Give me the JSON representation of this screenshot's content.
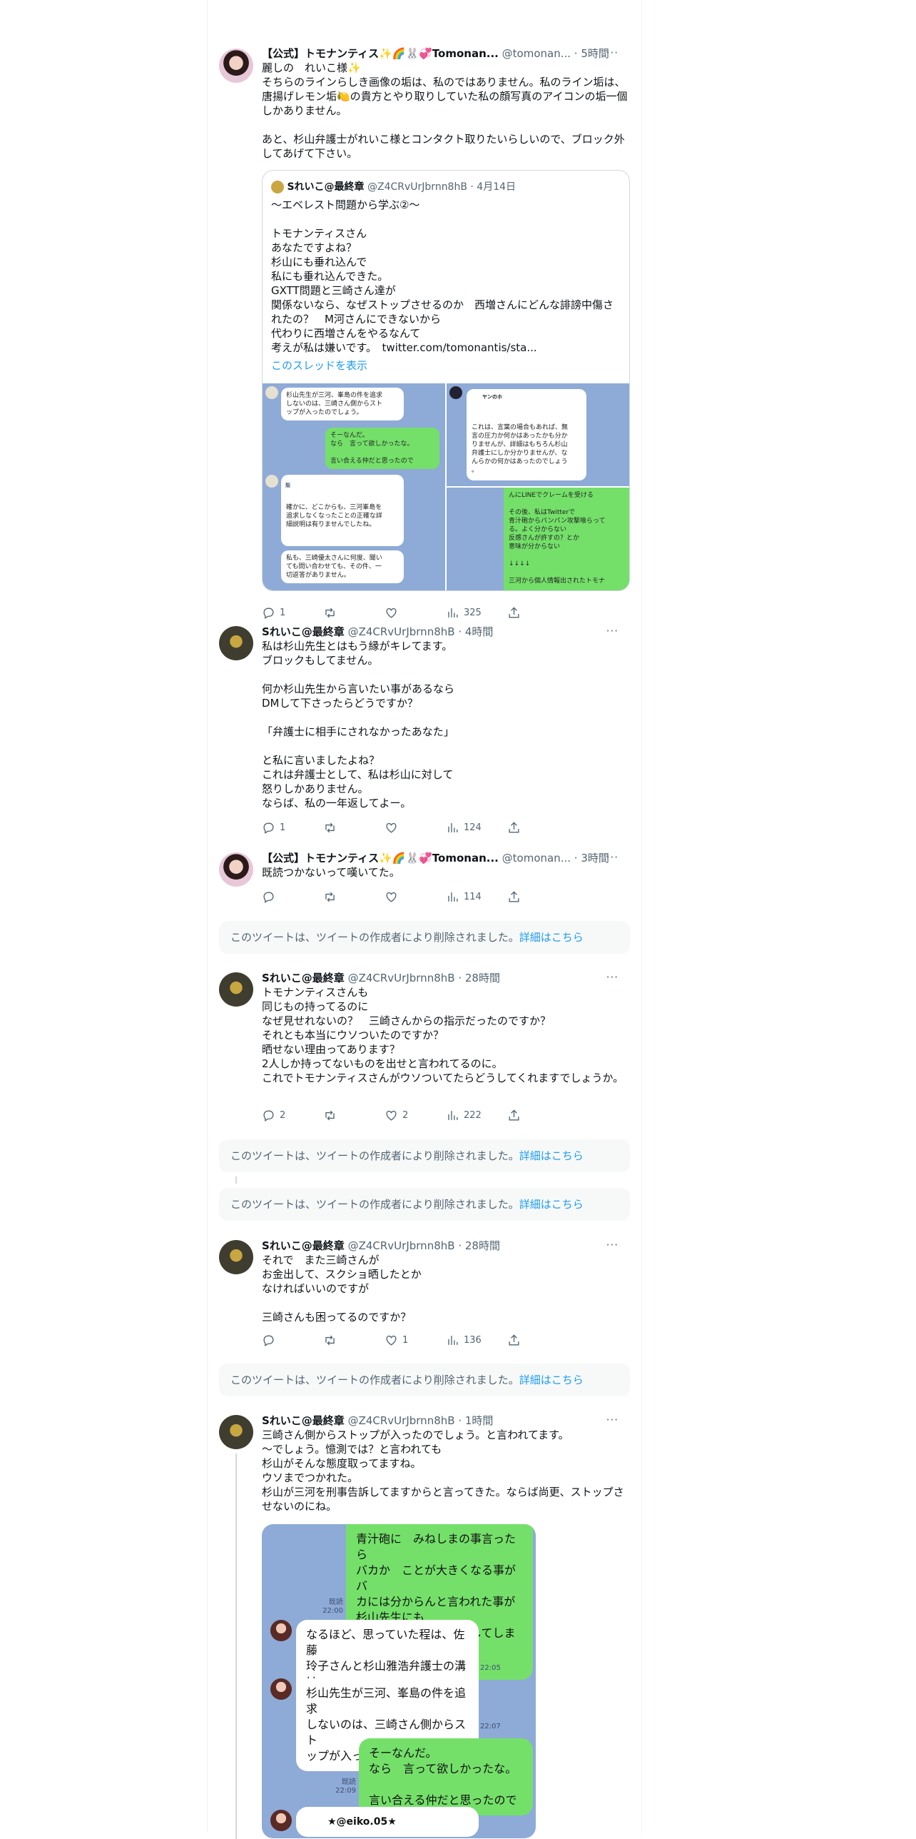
{
  "tweets": [
    {
      "name": "【公式】トモナンティス✨🌈🐰💞Tomonan...",
      "handle": "@tomonan...",
      "time": "· 5時間",
      "text": "麗しの　れいこ様✨\nそちらのラインらしき画像の垢は、私のではありません。私のライン垢は、唐揚げレモン垢🍋の貴方とやり取りしていた私の顔写真のアイコンの垢一個しかありません。\n\nあと、杉山弁護士がれいこ様とコンタクト取りたいらしいので、ブロック外してあげて下さい。",
      "quote": {
        "name": "Sれいこ@最終章",
        "handle": "@Z4CRvUrJbrnn8hB",
        "time": "· 4月14日",
        "text": "〜エベレスト問題から学ぶ②〜\n\nトモナンティスさん\nあなたですよね？\n杉山にも垂れ込んで\n私にも垂れ込んできた。\nGXTT問題と三崎さん達が\n関係ないなら、なぜストップさせるのか　西増さんにどんな誹謗中傷されたの？　M河さんにできないから\n代わりに西増さんをやるなんて\n考えが私は嫌いです。　twitter.com/tomonantis/sta...",
        "show_thread": "このスレッドを表示",
        "images": {
          "a": [
            "杉山先生が三河、峯島の件を追求\nしないのは、三崎さん側からスト\nップが入ったのでしょう。",
            "そーなんだ。\nなら　言って欲しかったな。\n\n言い合える仲だと思ったので",
            "確かに、どこからも、三河峯島を\n追求しなくなったことの正確な詳\n細説明は有りませんでしたね。",
            "私も、三崎優太さんに何度、聞い\nても問い合わせても、その件、一\n切返答がありません。"
          ],
          "b": [
            "これは、言葉の場合もあれば、無\n言の圧力か何かはあったかも分か\nりませんが、詳細はもちろん杉山\n弁護士にしか分かりませんが、な\nんらかの何かはあったのでしょう\n。"
          ],
          "c": [
            "んにLINEでクレームを受ける\n\nその後、私はTwitterで\n青汁砲からバンバン攻撃喰らって\nる。よく分からない\n反感さんが許すの？とか\n意味が分からない\n\n↓↓↓↓\n\n三河から個人情報出されたトモナ"
          ],
          "labels": [
            "ヤンのホ",
            "梨"
          ]
        }
      },
      "replies": "1",
      "retweets": "",
      "likes": "",
      "views": "325"
    },
    {
      "name": "Sれいこ@最終章",
      "handle": "@Z4CRvUrJbrnn8hB",
      "time": "· 4時間",
      "text": "私は杉山先生とはもう縁がキレてます。\nブロックもしてません。\n\n何か杉山先生から言いたい事があるなら\nDMして下さったらどうですか？\n\n「弁護士に相手にされなかったあなた」\n\nと私に言いましたよね？\nこれは弁護士として、私は杉山に対して\n怒りしかありません。\nならば、私の一年返してよー。",
      "replies": "1",
      "retweets": "",
      "likes": "",
      "views": "124"
    },
    {
      "name": "【公式】トモナンティス✨🌈🐰💞Tomonan...",
      "handle": "@tomonan...",
      "time": "· 3時間",
      "text": "既読つかないって嘆いてた。",
      "replies": "",
      "retweets": "",
      "likes": "",
      "views": "114"
    },
    {
      "name": "Sれいこ@最終章",
      "handle": "@Z4CRvUrJbrnn8hB",
      "time": "· 28時間",
      "text": "トモナンティスさんも\n同じもの持ってるのに\nなぜ見せれないの？　三崎さんからの指示だったのですか？\nそれとも本当にウソついたのですか？\n晒せない理由ってあります？\n2人しか持ってないものを出せと言われてるのに。\nこれでトモナンティスさんがウソついてたらどうしてくれますでしょうか。",
      "replies": "2",
      "retweets": "",
      "likes": "2",
      "views": "222"
    },
    {
      "name": "Sれいこ@最終章",
      "handle": "@Z4CRvUrJbrnn8hB",
      "time": "· 28時間",
      "text": "それで　また三崎さんが\nお金出して、スクショ晒したとか\nなければいいのですが\n\n三崎さんも困ってるのですか？",
      "replies": "",
      "retweets": "",
      "likes": "1",
      "views": "136"
    },
    {
      "name": "Sれいこ@最終章",
      "handle": "@Z4CRvUrJbrnn8hB",
      "time": "· 1時間",
      "text": "三崎さん側からストップが入ったのでしょう。と言われてます。\n〜でしょう。憶測では？と言われても\n杉山がそんな態度取ってますね。\nウソまでつかれた。\n杉山が三河を刑事告訴してますからと言ってきた。ならば尚更、ストップさせないのにね。",
      "line_image": {
        "g1": "青汁砲に　みねしまの事言ったら\nバカか　ことが大きくなる事がバ\nカには分からんと言われた事が\n杉山先生にも\n裏切られたと　リンクしてしまっ\nたのは　申し訳ない",
        "t1": "既読\n22:00",
        "w1": "なるほど、思っていた程は、佐藤\n玲子さんと杉山雅浩弁護士の溝は\n深くないですね。",
        "t2": "22:05",
        "w2": "杉山先生が三河、峯島の件を追求\nしないのは、三崎さん側からスト\nップが入ったのでしょう。",
        "t3": "22:07",
        "g2": "そーなんだ。\nなら　言って欲しかったな。\n\n言い合える仲だと思ったので",
        "t4": "既読\n22:09",
        "w3": "★@eiko.05★"
      }
    }
  ],
  "deleted": {
    "text": "このツイートは、ツイートの作成者により削除されました。",
    "link": "詳細はこちら"
  },
  "more_icon": "···"
}
